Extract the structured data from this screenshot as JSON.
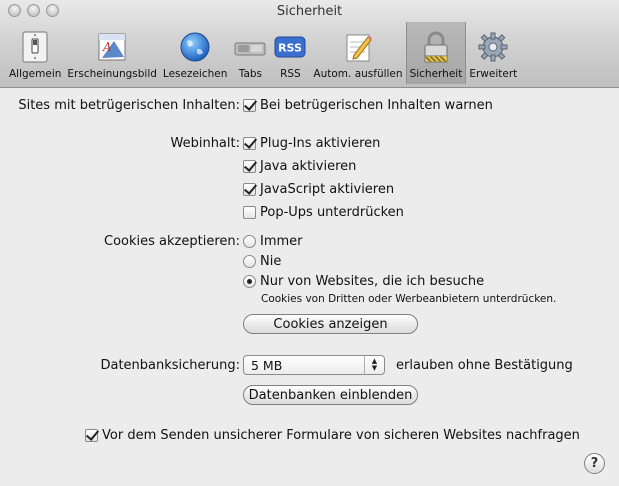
{
  "window": {
    "title": "Sicherheit"
  },
  "toolbar": {
    "items": [
      {
        "label": "Allgemein",
        "icon": "switch-icon"
      },
      {
        "label": "Erscheinungsbild",
        "icon": "font-icon"
      },
      {
        "label": "Lesezeichen",
        "icon": "globe-icon"
      },
      {
        "label": "Tabs",
        "icon": "tabs-icon"
      },
      {
        "label": "RSS",
        "icon": "rss-icon"
      },
      {
        "label": "Autom. ausfüllen",
        "icon": "pencil-paper-icon"
      },
      {
        "label": "Sicherheit",
        "icon": "lock-icon",
        "selected": true
      },
      {
        "label": "Erweitert",
        "icon": "gear-icon"
      }
    ]
  },
  "fraud": {
    "label": "Sites mit betrügerischen Inhalten:",
    "option": "Bei betrügerischen Inhalten warnen",
    "checked": true
  },
  "webcontent": {
    "label": "Webinhalt:",
    "options": [
      {
        "text": "Plug-Ins aktivieren",
        "checked": true
      },
      {
        "text": "Java aktivieren",
        "checked": true
      },
      {
        "text": "JavaScript aktivieren",
        "checked": true
      },
      {
        "text": "Pop-Ups unterdrücken",
        "checked": false
      }
    ]
  },
  "cookies": {
    "label": "Cookies akzeptieren:",
    "options": [
      {
        "text": "Immer",
        "selected": false
      },
      {
        "text": "Nie",
        "selected": false
      },
      {
        "text": "Nur von Websites, die ich besuche",
        "selected": true
      }
    ],
    "note": "Cookies von Dritten oder Werbeanbietern unterdrücken.",
    "show_button": "Cookies anzeigen"
  },
  "database": {
    "label": "Datenbanksicherung:",
    "value": "5 MB",
    "suffix": "erlauben ohne Bestätigung",
    "show_button": "Datenbanken einblenden"
  },
  "forms": {
    "option": "Vor dem Senden unsicherer Formulare von sicheren Websites nachfragen",
    "checked": true
  },
  "help": {
    "label": "?"
  },
  "colors": {
    "toolbar_selected": "#a8a8a8",
    "window_bg": "#ececec",
    "rss_blue": "#3a6fd0"
  }
}
